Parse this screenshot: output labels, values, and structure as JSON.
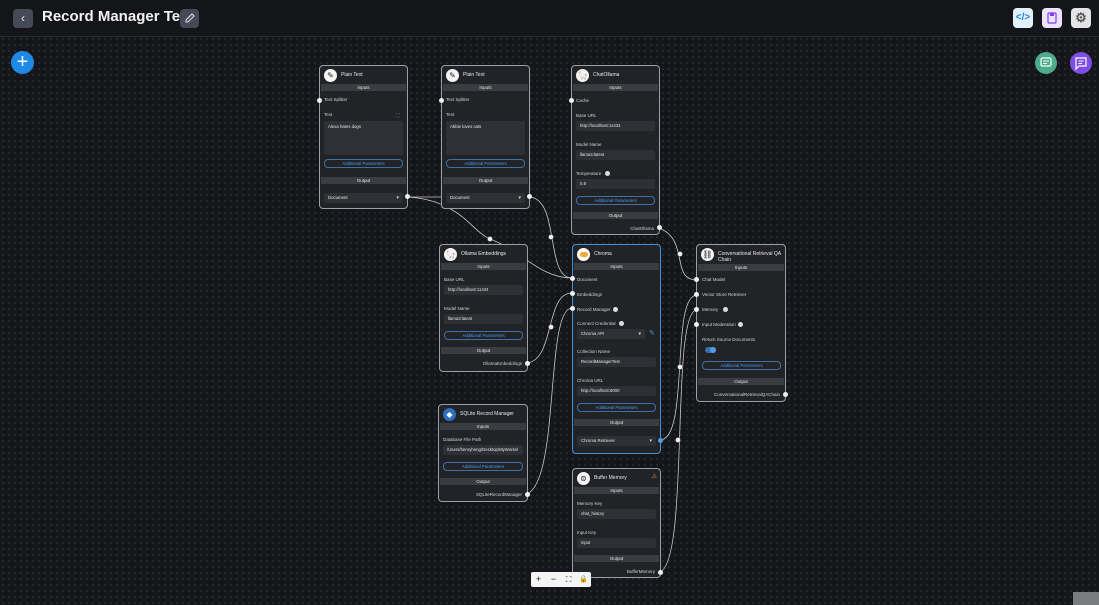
{
  "header": {
    "back_icon": "arrow-left-icon",
    "title": "Record Manager Test",
    "edit_icon": "pencil-icon",
    "api_icon": "code-icon",
    "save_icon": "save-icon",
    "settings_icon": "gear-icon"
  },
  "fabs": {
    "add_label": "+",
    "chat_icon": "chat-icon",
    "message_icon": "message-icon"
  },
  "nodes": {
    "plain_text_1": {
      "title": "Plain Text",
      "inputs_label": "Inputs",
      "text_splitter_label": "Text Splitter",
      "text_label": "Text",
      "text_value": "Alexa hates dogs",
      "additional_params": "Additional Parameters",
      "output_label": "Output",
      "output_value": "Document"
    },
    "plain_text_2": {
      "title": "Plain Text",
      "inputs_label": "Inputs",
      "text_splitter_label": "Text Splitter",
      "text_label": "Text",
      "text_value": "Abbie loves cats",
      "additional_params": "Additional Parameters",
      "output_label": "Output",
      "output_value": "Document"
    },
    "chat_ollama": {
      "title": "ChatOllama",
      "inputs_label": "Inputs",
      "cache_label": "Cache",
      "base_url_label": "Base URL",
      "base_url_value": "http://localhost:11434",
      "model_name_label": "Model Name",
      "model_name_value": "llama3:latest",
      "temperature_label": "Temperature",
      "temperature_value": "0.8",
      "additional_params": "Additional Parameters",
      "output_label": "Output",
      "output_value": "ChatOllama"
    },
    "ollama_embeddings": {
      "title": "Ollama Embeddings",
      "inputs_label": "Inputs",
      "base_url_label": "Base URL",
      "base_url_value": "http://localhost:11434",
      "model_name_label": "Model Name",
      "model_name_value": "llama3:latest",
      "additional_params": "Additional Parameters",
      "output_label": "Output",
      "output_value": "OllamaEmbeddings"
    },
    "chroma": {
      "title": "Chroma",
      "inputs_label": "Inputs",
      "document_label": "Document",
      "embeddings_label": "Embeddings",
      "record_manager_label": "Record Manager",
      "credential_label": "Connect Credential",
      "credential_value": "Chroma API",
      "collection_label": "Collection Name",
      "collection_value": "RecordManagerTest",
      "url_label": "Chroma URL",
      "url_value": "http://localhost:8000",
      "additional_params": "Additional Parameters",
      "output_label": "Output",
      "output_value": "Chroma Retriever"
    },
    "conv_chain": {
      "title": "Conversational Retrieval QA Chain",
      "inputs_label": "Inputs",
      "chat_model_label": "Chat Model",
      "retriever_label": "Vector Store Retriever",
      "memory_label": "Memory",
      "moderation_label": "Input Moderation",
      "return_docs_label": "Return Source Documents",
      "additional_params": "Additional Parameters",
      "output_label": "Output",
      "output_value": "ConversationalRetrievalQAChain"
    },
    "sqlite_rm": {
      "title": "SQLite Record Manager",
      "inputs_label": "Inputs",
      "db_path_label": "Database File Path",
      "db_path_value": "/Users/henryheng/Desktop/MyWorks/",
      "additional_params": "Additional Parameters",
      "output_label": "Output",
      "output_value": "SQLiteRecordManager"
    },
    "buffer_memory": {
      "title": "Buffer Memory",
      "inputs_label": "Inputs",
      "memory_key_label": "Memory Key",
      "memory_key_value": "chat_history",
      "input_key_label": "Input Key",
      "input_key_value": "input",
      "output_label": "Output",
      "output_value": "BufferMemory"
    }
  },
  "controls": {
    "zoom_in": "+",
    "zoom_out": "−",
    "fit": "⛶",
    "lock": "🔒"
  }
}
